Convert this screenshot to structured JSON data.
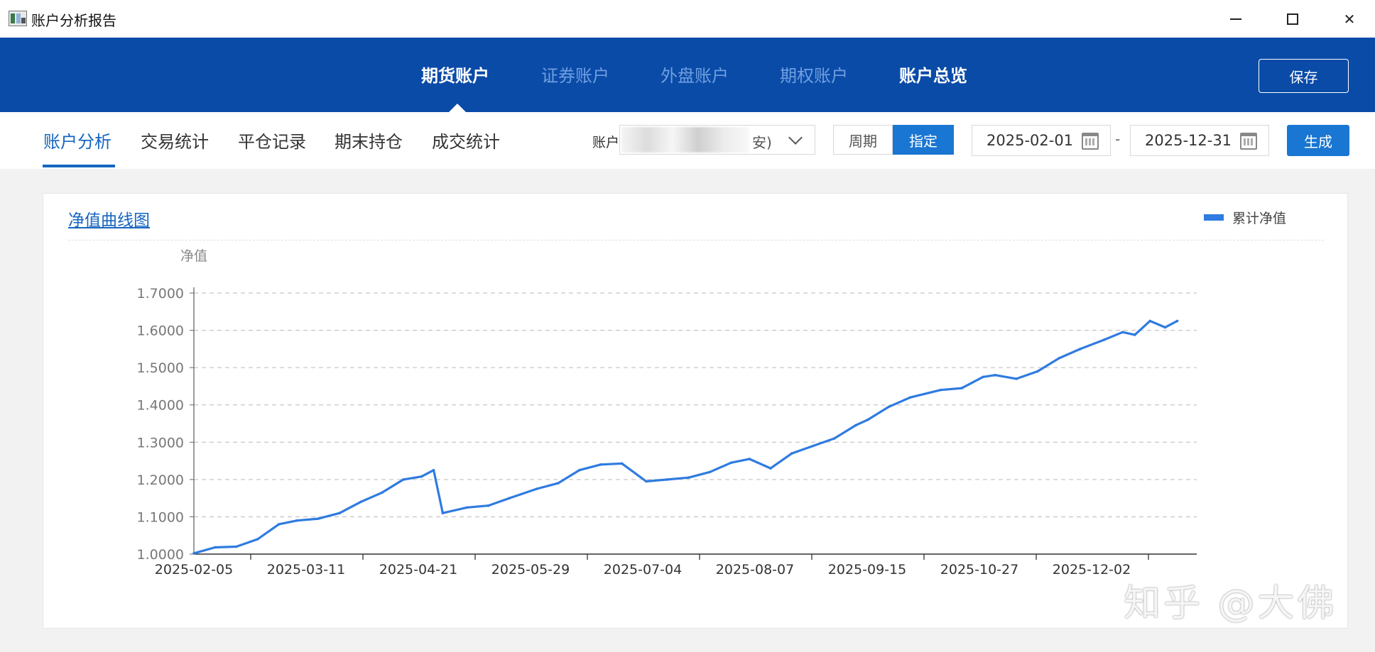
{
  "window": {
    "title": "账户分析报告"
  },
  "topnav": {
    "items": [
      "期货账户",
      "证券账户",
      "外盘账户",
      "期权账户",
      "账户总览"
    ],
    "active": 0,
    "save_label": "保存"
  },
  "subnav": {
    "tabs": [
      "账户分析",
      "交易统计",
      "平仓记录",
      "期末持仓",
      "成交统计"
    ],
    "active": 0,
    "account_label": "账户",
    "account_value_tail": "安)",
    "period_label": "周期",
    "custom_label": "指定",
    "start_date": "2025-02-01",
    "end_date": "2025-12-31",
    "date_separator": "-",
    "generate_label": "生成"
  },
  "chart_card": {
    "title": "净值曲线图"
  },
  "watermark": "知乎 @大佛",
  "colors": {
    "nav_bg": "#0a4ba8",
    "accent": "#1976d2",
    "line": "#2f7be0"
  },
  "chart_data": {
    "type": "line",
    "title": "净值曲线图",
    "ylabel": "净值",
    "xlabel": "",
    "ylim": [
      1.0,
      1.7
    ],
    "yticks": [
      "1.0000",
      "1.1000",
      "1.2000",
      "1.3000",
      "1.4000",
      "1.5000",
      "1.6000",
      "1.7000"
    ],
    "xtick_labels": [
      "2025-02-05",
      "2025-03-11",
      "2025-04-21",
      "2025-05-29",
      "2025-07-04",
      "2025-08-07",
      "2025-09-15",
      "2025-10-27",
      "2025-12-02"
    ],
    "grid": true,
    "legend_position": "top-right",
    "series": [
      {
        "name": "累计净值",
        "x": [
          "2025-02-05",
          "2025-02-12",
          "2025-02-19",
          "2025-02-26",
          "2025-03-05",
          "2025-03-11",
          "2025-03-18",
          "2025-03-25",
          "2025-04-01",
          "2025-04-08",
          "2025-04-15",
          "2025-04-21",
          "2025-04-25",
          "2025-04-28",
          "2025-05-06",
          "2025-05-13",
          "2025-05-20",
          "2025-05-29",
          "2025-06-05",
          "2025-06-12",
          "2025-06-19",
          "2025-06-26",
          "2025-07-04",
          "2025-07-11",
          "2025-07-18",
          "2025-07-25",
          "2025-08-01",
          "2025-08-07",
          "2025-08-14",
          "2025-08-21",
          "2025-08-28",
          "2025-09-04",
          "2025-09-11",
          "2025-09-15",
          "2025-09-22",
          "2025-09-29",
          "2025-10-09",
          "2025-10-16",
          "2025-10-23",
          "2025-10-27",
          "2025-11-03",
          "2025-11-10",
          "2025-11-17",
          "2025-11-24",
          "2025-12-02",
          "2025-12-08",
          "2025-12-12",
          "2025-12-17",
          "2025-12-22",
          "2025-12-26"
        ],
        "values": [
          1.002,
          1.018,
          1.02,
          1.04,
          1.08,
          1.09,
          1.095,
          1.11,
          1.14,
          1.165,
          1.2,
          1.208,
          1.225,
          1.11,
          1.125,
          1.13,
          1.15,
          1.175,
          1.19,
          1.225,
          1.24,
          1.243,
          1.195,
          1.2,
          1.205,
          1.22,
          1.245,
          1.255,
          1.23,
          1.27,
          1.29,
          1.31,
          1.345,
          1.36,
          1.395,
          1.42,
          1.44,
          1.445,
          1.475,
          1.48,
          1.47,
          1.49,
          1.525,
          1.55,
          1.575,
          1.595,
          1.588,
          1.625,
          1.608,
          1.625
        ]
      }
    ]
  }
}
